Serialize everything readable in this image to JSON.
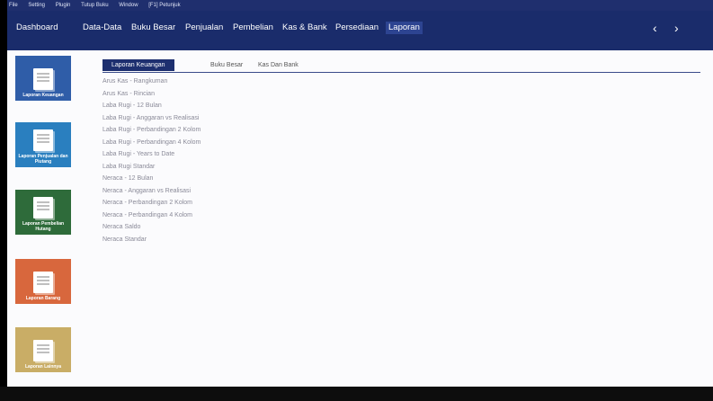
{
  "menubar": [
    "File",
    "Setting",
    "Plugin",
    "Tutup Buku",
    "Window",
    "[F1] Petunjuk"
  ],
  "nav": {
    "items": [
      "Dashboard",
      "Data-Data",
      "Buku Besar",
      "Penjualan",
      "Pembelian",
      "Kas & Bank",
      "Persediaan",
      "Laporan"
    ],
    "active": "Laporan",
    "prev": "‹",
    "next": "›"
  },
  "tiles": [
    {
      "label": "Laporan Keuangan",
      "color": "#2f5da8"
    },
    {
      "label": "Laporan Penjualan dan Piutang",
      "color": "#2a7fbf"
    },
    {
      "label": "Laporan Pembelian Hutang",
      "color": "#2e6b3a"
    },
    {
      "label": "Laporan Barang",
      "color": "#d8673d"
    },
    {
      "label": "Laporan Lainnya",
      "color": "#c9ad66"
    }
  ],
  "tabs": [
    "Laporan Keuangan",
    "Buku Besar",
    "Kas Dan Bank"
  ],
  "reports": [
    "Arus Kas - Rangkuman",
    "Arus Kas - Rincian",
    "Laba Rugi - 12 Bulan",
    "Laba Rugi - Anggaran vs Realisasi",
    "Laba Rugi - Perbandingan 2 Kolom",
    "Laba Rugi - Perbandingan 4 Kolom",
    "Laba Rugi - Years to Date",
    "Laba Rugi Standar",
    "Neraca - 12 Bulan",
    "Neraca - Anggaran vs Realisasi",
    "Neraca - Perbandingan 2 Kolom",
    "Neraca - Perbandingan 4 Kolom",
    "Neraca Saldo",
    "Neraca Standar"
  ]
}
